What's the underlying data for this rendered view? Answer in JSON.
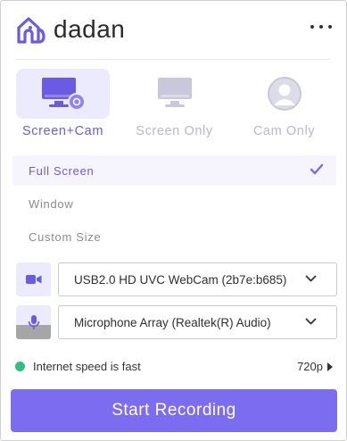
{
  "app": {
    "name": "dadan"
  },
  "colors": {
    "accent": "#7b6cf0",
    "accent_dark": "#6a5be2",
    "accent_light": "#eceafd",
    "inactive": "#c9c8da",
    "status_ok": "#2ec27e"
  },
  "modes": [
    {
      "label": "Screen+Cam",
      "icon": "monitor-cam-icon",
      "selected": true
    },
    {
      "label": "Screen Only",
      "icon": "monitor-icon",
      "selected": false
    },
    {
      "label": "Cam Only",
      "icon": "user-avatar-icon",
      "selected": false
    }
  ],
  "area_options": [
    {
      "label": "Full Screen",
      "selected": true
    },
    {
      "label": "Window",
      "selected": false
    },
    {
      "label": "Custom Size",
      "selected": false
    }
  ],
  "devices": {
    "camera": {
      "value": "USB2.0 HD UVC WebCam (2b7e:b685)",
      "icon": "video-camera-icon"
    },
    "microphone": {
      "value": "Microphone Array (Realtek(R) Audio)",
      "icon": "microphone-icon"
    }
  },
  "status": {
    "text": "Internet speed is fast",
    "quality": "720p"
  },
  "actions": {
    "start_label": "Start Recording"
  }
}
